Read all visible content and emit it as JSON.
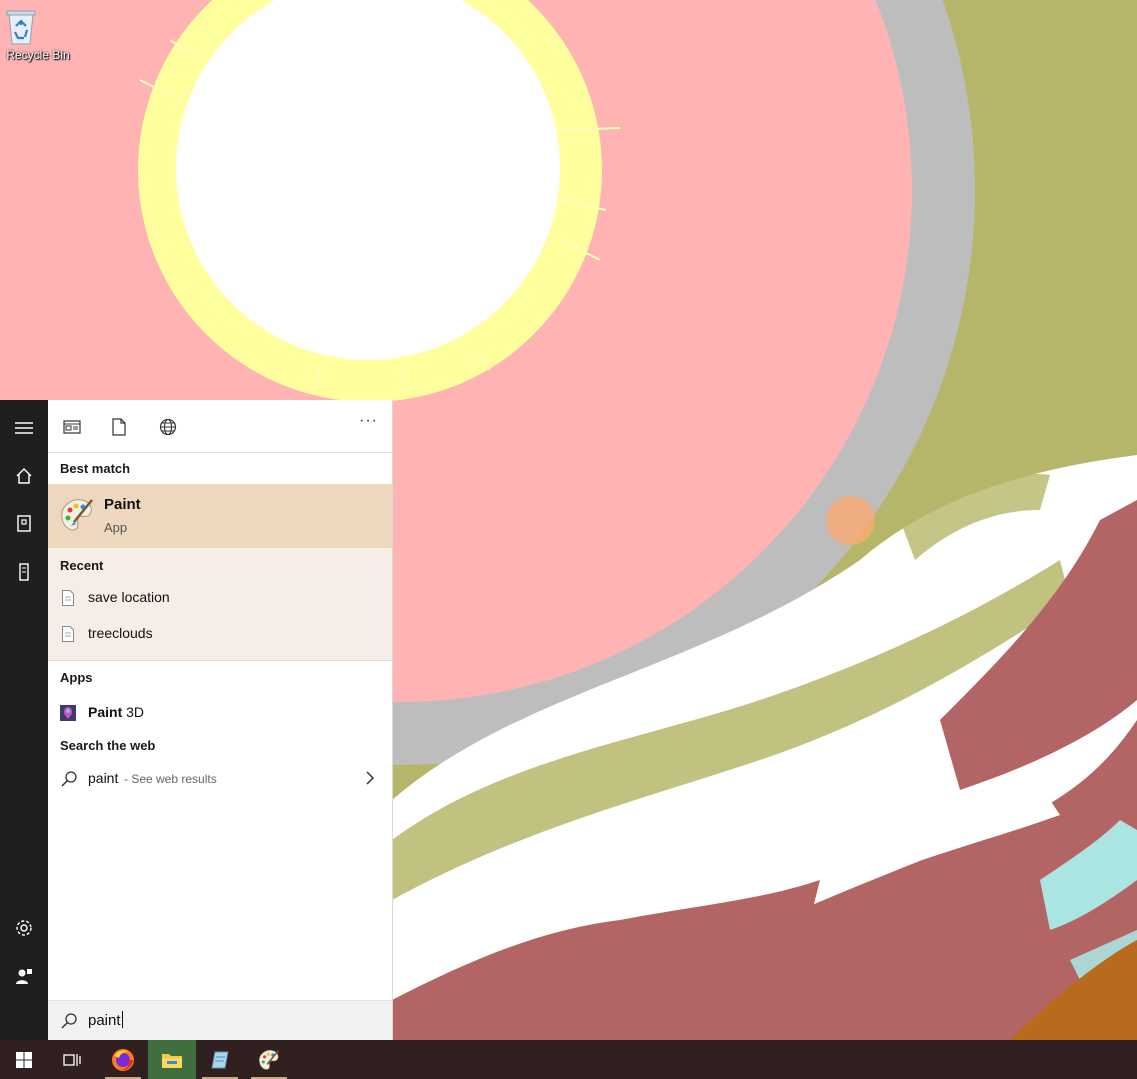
{
  "desktop": {
    "recycle_bin_label": "Recycle Bin"
  },
  "start_menu": {
    "rail": {
      "icons": [
        "hamburger-icon",
        "home-icon",
        "documents-icon",
        "device-icon",
        "settings-icon",
        "user-feedback-icon"
      ]
    },
    "tabs": {
      "icons": [
        "apps-tab-icon",
        "documents-tab-icon",
        "web-tab-icon"
      ],
      "more_label": "···"
    },
    "best_match": {
      "header": "Best match",
      "title": "Paint",
      "subtitle": "App",
      "icon": "paint-icon"
    },
    "recent": {
      "header": "Recent",
      "items": [
        {
          "label": "save location",
          "icon": "document-icon"
        },
        {
          "label": "treeclouds",
          "icon": "document-icon"
        }
      ]
    },
    "apps": {
      "header": "Apps",
      "items": [
        {
          "label_bold": "Paint",
          "label_rest": " 3D",
          "icon": "paint-3d-icon"
        }
      ]
    },
    "search_web": {
      "header": "Search the web",
      "query": "paint",
      "suffix": " - See web results",
      "icon": "search-icon"
    },
    "search_box": {
      "value": "paint",
      "icon": "search-icon"
    }
  },
  "taskbar": {
    "items": [
      "start-icon",
      "task-view-icon",
      "firefox-icon",
      "file-explorer-icon",
      "notepad-icon",
      "paint-icon"
    ]
  },
  "colors": {
    "wallpaper_pink": "#ffb3b3",
    "wallpaper_olive": "#b6b66a",
    "wallpaper_gray": "#bdbdbd",
    "wallpaper_maroon": "#b36464",
    "best_match_bg": "#edd7bf",
    "recent_bg": "#f6ede7",
    "taskbar_bg": "#302020"
  }
}
